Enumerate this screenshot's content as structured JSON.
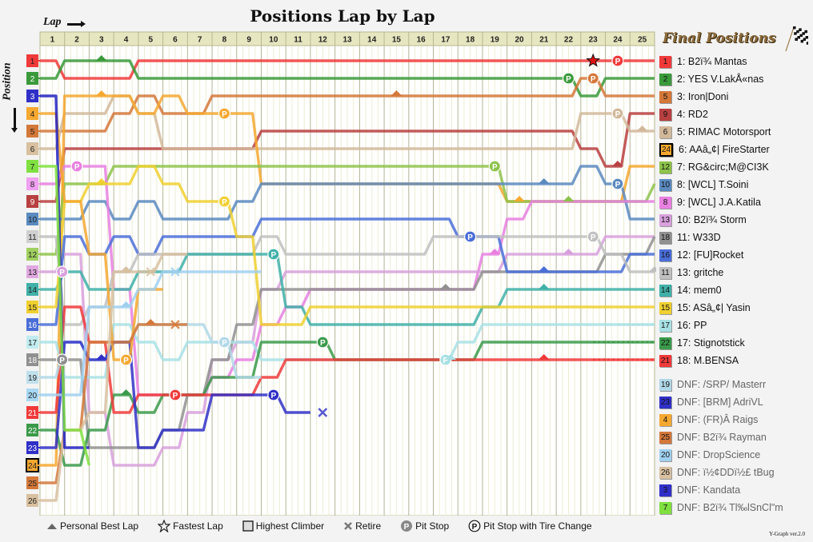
{
  "chart_data": {
    "type": "line",
    "title": "Positions Lap by Lap",
    "xlabel": "Lap",
    "ylabel": "Position",
    "laps": [
      1,
      2,
      3,
      4,
      5,
      6,
      7,
      8,
      9,
      10,
      11,
      12,
      13,
      14,
      15,
      16,
      17,
      18,
      19,
      20,
      21,
      22,
      23,
      24,
      25
    ],
    "grid_positions": [
      1,
      2,
      3,
      4,
      5,
      6,
      7,
      8,
      9,
      10,
      11,
      12,
      13,
      14,
      15,
      16,
      17,
      18,
      19,
      20,
      21,
      22,
      23,
      24,
      25,
      26
    ],
    "ylim": [
      1,
      26
    ],
    "series": [
      {
        "grid": 1,
        "name": "B2ï¾ Mantas",
        "color": "#f03a3a",
        "positions": [
          2,
          2,
          2,
          1,
          1,
          1,
          1,
          1,
          1,
          1,
          1,
          1,
          1,
          1,
          1,
          1,
          1,
          1,
          1,
          1,
          1,
          1,
          1,
          1,
          1
        ],
        "final": 1,
        "markers": [
          {
            "lap": 22.5,
            "type": "fastest"
          },
          {
            "lap": 23.5,
            "type": "pit"
          }
        ]
      },
      {
        "grid": 2,
        "name": "YES V.LakÅ«nas",
        "color": "#3a9a3a",
        "positions": [
          1,
          1,
          1,
          2,
          2,
          2,
          2,
          2,
          2,
          2,
          2,
          2,
          2,
          2,
          2,
          2,
          2,
          2,
          2,
          2,
          2,
          3,
          2,
          2,
          2
        ],
        "final": 2,
        "markers": [
          {
            "lap": 2.5,
            "type": "best"
          },
          {
            "lap": 21.5,
            "type": "pit"
          }
        ]
      },
      {
        "grid": 5,
        "name": "Iron|Doni",
        "color": "#d4783a",
        "positions": [
          5,
          5,
          4,
          3,
          4,
          4,
          3,
          3,
          3,
          3,
          3,
          3,
          3,
          3,
          3,
          3,
          3,
          3,
          3,
          3,
          3,
          2,
          3,
          3,
          3
        ],
        "final": 3,
        "markers": [
          {
            "lap": 14.5,
            "type": "best"
          },
          {
            "lap": 22.5,
            "type": "pit"
          }
        ]
      },
      {
        "grid": 9,
        "name": "RD2",
        "color": "#b84040",
        "positions": [
          6,
          6,
          6,
          6,
          6,
          6,
          6,
          6,
          5,
          5,
          5,
          5,
          5,
          5,
          5,
          5,
          5,
          5,
          5,
          5,
          5,
          6,
          7,
          4,
          4
        ],
        "final": 4,
        "markers": [
          {
            "lap": 23.5,
            "type": "best"
          }
        ]
      },
      {
        "grid": 6,
        "name": "RIMAC Motorsport",
        "color": "#d2b89a",
        "positions": [
          4,
          4,
          3,
          4,
          6,
          6,
          6,
          6,
          6,
          6,
          6,
          6,
          6,
          6,
          6,
          6,
          6,
          6,
          6,
          6,
          6,
          4,
          4,
          5,
          5
        ],
        "final": 5,
        "markers": [
          {
            "lap": 23.5,
            "type": "pit"
          },
          {
            "lap": 24.5,
            "type": "best"
          }
        ]
      },
      {
        "grid": 24,
        "name": "AAâ„¢| FireStarter",
        "color": "#f5a830",
        "positions": [
          3,
          3,
          3,
          4,
          3,
          4,
          4,
          4,
          8,
          8,
          8,
          8,
          8,
          8,
          8,
          8,
          8,
          8,
          9,
          9,
          9,
          9,
          9,
          7,
          7
        ],
        "final": 6,
        "markers": [
          {
            "lap": 2.5,
            "type": "best"
          },
          {
            "lap": 7.5,
            "type": "pit"
          },
          {
            "lap": 19.5,
            "type": "best"
          }
        ]
      },
      {
        "grid": 12,
        "name": "RG&circ;M@CI3K",
        "color": "#8dc34a",
        "positions": [
          8,
          8,
          7,
          7,
          7,
          7,
          7,
          7,
          7,
          7,
          7,
          7,
          7,
          7,
          7,
          7,
          7,
          7,
          9,
          9,
          9,
          9,
          9,
          9,
          8
        ],
        "final": 7,
        "markers": [
          {
            "lap": 18.5,
            "type": "pit"
          },
          {
            "lap": 21.5,
            "type": "best"
          }
        ]
      },
      {
        "grid": 10,
        "name": "[WCL] T.Soini",
        "color": "#5a8ac0",
        "positions": [
          10,
          9,
          10,
          9,
          10,
          10,
          10,
          9,
          8,
          8,
          8,
          8,
          8,
          8,
          8,
          8,
          8,
          8,
          8,
          8,
          8,
          7,
          8,
          10,
          10
        ],
        "final": 8,
        "markers": [
          {
            "lap": 20.5,
            "type": "best"
          },
          {
            "lap": 23.5,
            "type": "pit"
          }
        ]
      },
      {
        "grid": 8,
        "name": "[WCL] J.A.Katila",
        "color": "#e880e0",
        "positions": [
          7,
          7,
          14,
          20,
          20,
          20,
          19,
          18,
          16,
          15,
          14,
          14,
          14,
          14,
          14,
          14,
          14,
          12,
          10,
          9,
          9,
          9,
          9,
          9,
          9
        ],
        "final": 9,
        "markers": [
          {
            "lap": 1.5,
            "type": "pit"
          },
          {
            "lap": 18.5,
            "type": "best"
          }
        ]
      },
      {
        "grid": 13,
        "name": "B2ï¾ Storm",
        "color": "#d8a0dc",
        "positions": [
          12,
          21,
          24,
          24,
          23,
          21,
          18,
          17,
          14,
          13,
          13,
          13,
          13,
          13,
          13,
          13,
          13,
          13,
          12,
          12,
          12,
          12,
          11,
          11,
          11
        ],
        "final": 10,
        "markers": [
          {
            "lap": 0.9,
            "type": "pit"
          },
          {
            "lap": 21.5,
            "type": "best"
          }
        ]
      },
      {
        "grid": 18,
        "name": "W33D",
        "color": "#909090",
        "positions": [
          18,
          23,
          23,
          23,
          22,
          20,
          18,
          16,
          14,
          14,
          14,
          14,
          14,
          14,
          14,
          14,
          14,
          13,
          13,
          13,
          13,
          13,
          12,
          12,
          11
        ],
        "final": 11,
        "markers": [
          {
            "lap": 0.9,
            "type": "pit"
          },
          {
            "lap": 16.5,
            "type": "best"
          }
        ]
      },
      {
        "grid": 16,
        "name": "[FU]Rocket",
        "color": "#4a6ed8",
        "positions": [
          11,
          12,
          11,
          12,
          11,
          11,
          11,
          11,
          10,
          10,
          10,
          10,
          10,
          10,
          10,
          10,
          11,
          11,
          13,
          13,
          13,
          13,
          13,
          12,
          12
        ],
        "final": 12,
        "markers": [
          {
            "lap": 17.5,
            "type": "pit"
          },
          {
            "lap": 20.5,
            "type": "best"
          }
        ]
      },
      {
        "grid": 11,
        "name": "gritche",
        "color": "#c0c0c0",
        "positions": [
          16,
          15,
          13,
          12,
          12,
          12,
          12,
          12,
          11,
          12,
          12,
          12,
          12,
          12,
          12,
          11,
          11,
          11,
          11,
          11,
          11,
          11,
          12,
          13,
          13
        ],
        "final": 13,
        "markers": [
          {
            "lap": 22.5,
            "type": "pit"
          },
          {
            "lap": 25,
            "type": "best"
          }
        ]
      },
      {
        "grid": 14,
        "name": "mem0",
        "color": "#40b0a8",
        "positions": [
          13,
          14,
          14,
          13,
          13,
          12,
          12,
          12,
          12,
          15,
          16,
          16,
          16,
          16,
          16,
          16,
          16,
          15,
          14,
          14,
          14,
          14,
          14,
          14,
          14
        ],
        "final": 14,
        "markers": [
          {
            "lap": 9.5,
            "type": "pit"
          },
          {
            "lap": 20.5,
            "type": "best"
          }
        ]
      },
      {
        "grid": 15,
        "name": "ASâ„¢| Yasin",
        "color": "#f0d030",
        "positions": [
          9,
          8,
          8,
          7,
          8,
          9,
          9,
          11,
          16,
          16,
          15,
          15,
          15,
          15,
          15,
          15,
          15,
          15,
          15,
          15,
          15,
          15,
          15,
          15,
          15
        ],
        "final": 15,
        "markers": [
          {
            "lap": 2.5,
            "type": "best"
          },
          {
            "lap": 7.5,
            "type": "pit"
          }
        ]
      },
      {
        "grid": 17,
        "name": "PP",
        "color": "#a8e0e4",
        "positions": [
          19,
          19,
          16,
          17,
          18,
          17,
          17,
          17,
          18,
          18,
          18,
          18,
          18,
          18,
          18,
          18,
          17,
          16,
          16,
          16,
          16,
          16,
          16,
          16,
          16
        ],
        "final": 16,
        "markers": [
          {
            "lap": 16.5,
            "type": "pit"
          },
          {
            "lap": 16.7,
            "type": "best"
          }
        ]
      },
      {
        "grid": 22,
        "name": "Stignotstick",
        "color": "#3a9a4a",
        "positions": [
          24,
          22,
          20,
          21,
          20,
          20,
          19,
          19,
          17,
          17,
          17,
          18,
          18,
          18,
          18,
          18,
          18,
          17,
          17,
          17,
          17,
          17,
          17,
          17,
          17
        ],
        "final": 17,
        "markers": [
          {
            "lap": 3.5,
            "type": "best"
          },
          {
            "lap": 11.5,
            "type": "pit"
          }
        ]
      },
      {
        "grid": 21,
        "name": "M.BENSA",
        "color": "#f03a3a",
        "positions": [
          15,
          17,
          21,
          20,
          20,
          20,
          20,
          20,
          19,
          18,
          18,
          18,
          18,
          18,
          18,
          18,
          18,
          18,
          18,
          18,
          18,
          18,
          18,
          18,
          18
        ],
        "final": 18,
        "markers": [
          {
            "lap": 5.5,
            "type": "pit"
          },
          {
            "lap": 20.5,
            "type": "best"
          }
        ]
      },
      {
        "grid": 19,
        "name": "/SRP/ Masterr",
        "color": "#b0d8e8",
        "positions": [
          17,
          18,
          17,
          16,
          16,
          16,
          17,
          19,
          19
        ],
        "final": null,
        "dnf": true,
        "markers": [
          {
            "lap": 7.5,
            "type": "pit"
          }
        ]
      },
      {
        "grid": 23,
        "name": "[BRM] AdriVL",
        "color": "#3030c8",
        "positions": [
          17,
          18,
          17,
          23,
          22,
          22,
          20,
          20,
          20,
          21,
          21
        ],
        "final": null,
        "dnf": true,
        "markers": [
          {
            "lap": 2.5,
            "type": "best"
          },
          {
            "lap": 9.5,
            "type": "pit"
          },
          {
            "lap": 11.5,
            "type": "retire"
          }
        ]
      },
      {
        "grid": 4,
        "name": "(FR)Â Raigs",
        "color": "#f5a830",
        "positions": [
          9,
          12,
          18,
          14,
          14
        ],
        "final": null,
        "dnf": true,
        "markers": [
          {
            "lap": 3.5,
            "type": "pit"
          }
        ]
      },
      {
        "grid": 25,
        "name": "B2ï¾ Rayman",
        "color": "#d4783a",
        "positions": [
          22,
          17,
          17,
          16,
          16,
          16
        ],
        "final": null,
        "dnf": true,
        "markers": [
          {
            "lap": 4.5,
            "type": "best"
          },
          {
            "lap": 5.5,
            "type": "retire"
          }
        ]
      },
      {
        "grid": 20,
        "name": "DropScience",
        "color": "#a0d0f0",
        "positions": [
          20,
          15,
          15,
          14,
          13,
          13,
          13,
          13,
          13
        ],
        "final": null,
        "dnf": true,
        "markers": [
          {
            "lap": 3.5,
            "type": "best"
          },
          {
            "lap": 5.5,
            "type": "retire"
          }
        ]
      },
      {
        "grid": 26,
        "name": "ï½¢DDï½£ tBug",
        "color": "#d8c0a0",
        "positions": [
          22,
          21,
          13,
          13,
          12,
          12
        ],
        "final": null,
        "dnf": true,
        "markers": [
          {
            "lap": 3.5,
            "type": "best"
          },
          {
            "lap": 4.5,
            "type": "retire"
          }
        ]
      },
      {
        "grid": 3,
        "name": "Kandata",
        "color": "#2020c0",
        "positions": [
          23,
          23
        ],
        "final": null,
        "dnf": true,
        "markers": []
      },
      {
        "grid": 7,
        "name": "B2ï¾ Tl‰lSnCl\"m",
        "color": "#80e040",
        "positions": [
          22,
          24
        ],
        "final": null,
        "dnf": true,
        "markers": []
      }
    ]
  },
  "header": {
    "title": "Positions Lap by Lap",
    "lap_label": "Lap",
    "position_label": "Position"
  },
  "final_positions": {
    "title": "Final Positions",
    "finishers": [
      {
        "grid": "1",
        "label": "1: B2ï¾ Mantas",
        "color": "#f03a3a"
      },
      {
        "grid": "2",
        "label": "2: YES V.LakÅ«nas",
        "color": "#3a9a3a"
      },
      {
        "grid": "5",
        "label": "3: Iron|Doni",
        "color": "#d4783a"
      },
      {
        "grid": "9",
        "label": "4: RD2",
        "color": "#b84040"
      },
      {
        "grid": "6",
        "label": "5: RIMAC Motorsport",
        "color": "#d2b89a"
      },
      {
        "grid": "24",
        "label": "6: AAâ„¢| FireStarter",
        "color": "#f5a830",
        "highlight": true
      },
      {
        "grid": "12",
        "label": "7: RG&circ;M@CI3K",
        "color": "#8dc34a"
      },
      {
        "grid": "10",
        "label": "8: [WCL] T.Soini",
        "color": "#5a8ac0"
      },
      {
        "grid": "8",
        "label": "9: [WCL] J.A.Katila",
        "color": "#e880e0"
      },
      {
        "grid": "13",
        "label": "10: B2ï¾ Storm",
        "color": "#d8a0dc"
      },
      {
        "grid": "18",
        "label": "11: W33D",
        "color": "#909090"
      },
      {
        "grid": "16",
        "label": "12: [FU]Rocket",
        "color": "#4a6ed8"
      },
      {
        "grid": "11",
        "label": "13: gritche",
        "color": "#c0c0c0"
      },
      {
        "grid": "14",
        "label": "14: mem0",
        "color": "#40b0a8"
      },
      {
        "grid": "15",
        "label": "15: ASâ„¢| Yasin",
        "color": "#f0d030"
      },
      {
        "grid": "17",
        "label": "16: PP",
        "color": "#a8e0e4"
      },
      {
        "grid": "22",
        "label": "17: Stignotstick",
        "color": "#3a9a4a"
      },
      {
        "grid": "21",
        "label": "18: M.BENSA",
        "color": "#f03a3a"
      }
    ],
    "dnf": [
      {
        "grid": "19",
        "label": "DNF: /SRP/ Masterr",
        "color": "#b0d8e8"
      },
      {
        "grid": "23",
        "label": "DNF: [BRM] AdriVL",
        "color": "#3030c8"
      },
      {
        "grid": "4",
        "label": "DNF: (FR)Â Raigs",
        "color": "#f5a830"
      },
      {
        "grid": "25",
        "label": "DNF: B2ï¾ Rayman",
        "color": "#d4783a"
      },
      {
        "grid": "20",
        "label": "DNF: DropScience",
        "color": "#a0d0f0"
      },
      {
        "grid": "26",
        "label": "DNF: ï½¢DDï½£ tBug",
        "color": "#d8c0a0"
      },
      {
        "grid": "3",
        "label": "DNF: Kandata",
        "color": "#3030c8"
      },
      {
        "grid": "7",
        "label": "DNF: B2ï¾ Tl‰lSnCl\"m",
        "color": "#80e040"
      }
    ]
  },
  "grid_colors": {
    "1": "#f03a3a",
    "2": "#3a9a3a",
    "3": "#3030c8",
    "4": "#f5a830",
    "5": "#d4783a",
    "6": "#d8c0a0",
    "7": "#80e040",
    "8": "#f0a0f0",
    "9": "#b84040",
    "10": "#5a8ac0",
    "11": "#d0d0d0",
    "12": "#a0d060",
    "13": "#e0a8e0",
    "14": "#40b0a8",
    "15": "#f0d030",
    "16": "#4a6ed8",
    "17": "#c0ecf0",
    "18": "#909090",
    "19": "#c0e0ec",
    "20": "#a8d8f4",
    "21": "#f03a3a",
    "22": "#3a9a4a",
    "23": "#3030c8",
    "24": "#f5a830",
    "25": "#d4783a",
    "26": "#d8c0a0"
  },
  "legend": {
    "personal_best": "Personal Best Lap",
    "fastest": "Fastest Lap",
    "highest_climber": "Highest Climber",
    "retire": "Retire",
    "pit_stop": "Pit Stop",
    "pit_tire": "Pit Stop with Tire Change"
  },
  "version": "Y-Graph ver.2.0"
}
